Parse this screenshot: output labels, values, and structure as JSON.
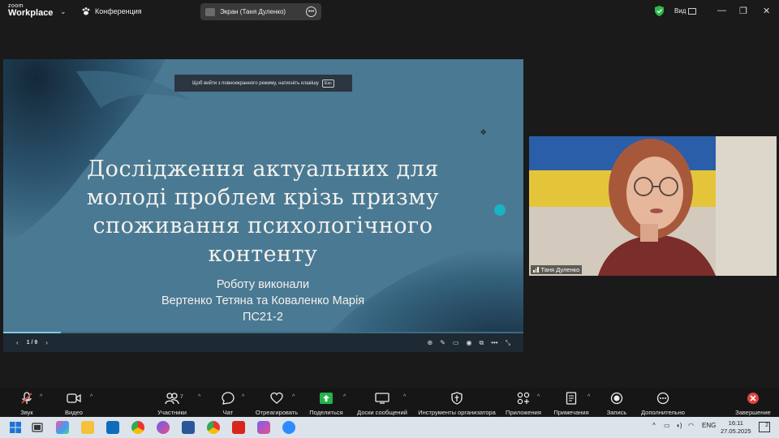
{
  "app": {
    "logo_line1": "zoom",
    "logo_line2": "Workplace",
    "meeting_label": "Конференция",
    "share_pill_label": "Экран (Таня Дуленко)",
    "view_label": "Вид"
  },
  "slide": {
    "esc_hint": "Щоб вийти з повноекранного режиму, натисніть клавішу",
    "esc_key": "Esc",
    "title_lines": [
      "Дослідження актуальних для",
      "молоді проблем крізь призму",
      "споживання психологічного",
      "контенту"
    ],
    "authors_lines": [
      "Роботу виконали",
      "Вертенко Тетяна та Коваленко Марія",
      "ПС21-2"
    ],
    "page_indicator": "1 / 9",
    "progress": 0.111,
    "colors": {
      "background": "#4a7993",
      "accent_dot": "#1ab3c4"
    }
  },
  "camera": {
    "participant_name": "Таня Дуленко"
  },
  "toolbar": {
    "audio": "Звук",
    "video": "Видео",
    "participants": "Участники",
    "participants_count": "7",
    "chat": "Чат",
    "react": "Отреагировать",
    "share": "Поделиться",
    "whiteboards": "Доски сообщений",
    "host_tools": "Инструменты организатора",
    "apps": "Приложения",
    "notes": "Примечания",
    "record": "Запись",
    "more": "Дополнительно",
    "end": "Завершение"
  },
  "taskbar": {
    "language": "ENG",
    "time": "16:11",
    "date": "27.05.2025",
    "notification_count": "2"
  }
}
